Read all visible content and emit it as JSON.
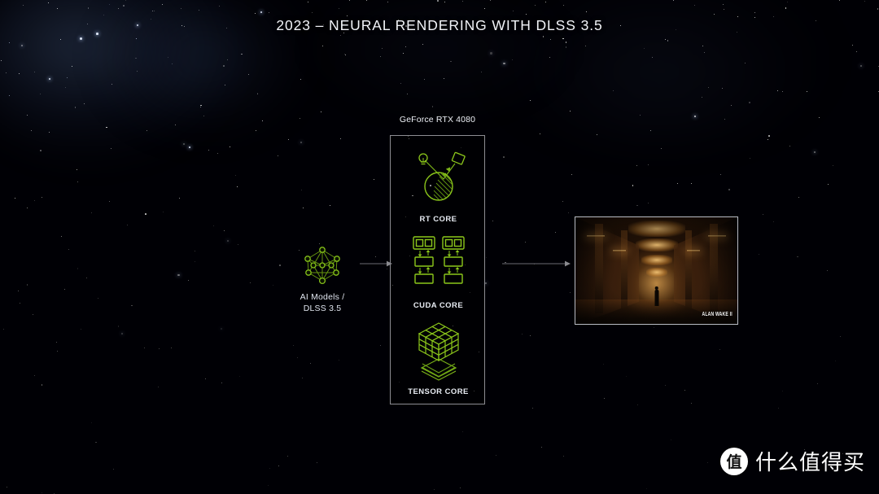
{
  "slide": {
    "title": "2023 – NEURAL RENDERING WITH DLSS 3.5",
    "background_color": "#000005",
    "accent_green": "#76b900",
    "text_color": "#eef1f6"
  },
  "ai_node": {
    "icon": "neural-network-icon",
    "caption": "AI Models /\nDLSS 3.5"
  },
  "gpu_card": {
    "title": "GeForce RTX 4080",
    "border_color": "#8d8d92",
    "cores": [
      {
        "label": "RT CORE",
        "icon": "ray-tracing-icon"
      },
      {
        "label": "CUDA CORE",
        "icon": "cuda-cores-icon"
      },
      {
        "label": "TENSOR CORE",
        "icon": "tensor-cube-icon"
      }
    ]
  },
  "arrows": [
    {
      "name": "arrow-ai-to-gpu",
      "color": "#6d6d72"
    },
    {
      "name": "arrow-gpu-to-output",
      "color": "#6d6d72"
    }
  ],
  "game_shot": {
    "logo": "ALAN WAKE II",
    "border_color": "#b9bcc4",
    "scene_description": "dark corridor with warm orange lighting and a silhouetted figure"
  },
  "watermark": {
    "badge_glyph": "值",
    "text": "什么值得买"
  }
}
